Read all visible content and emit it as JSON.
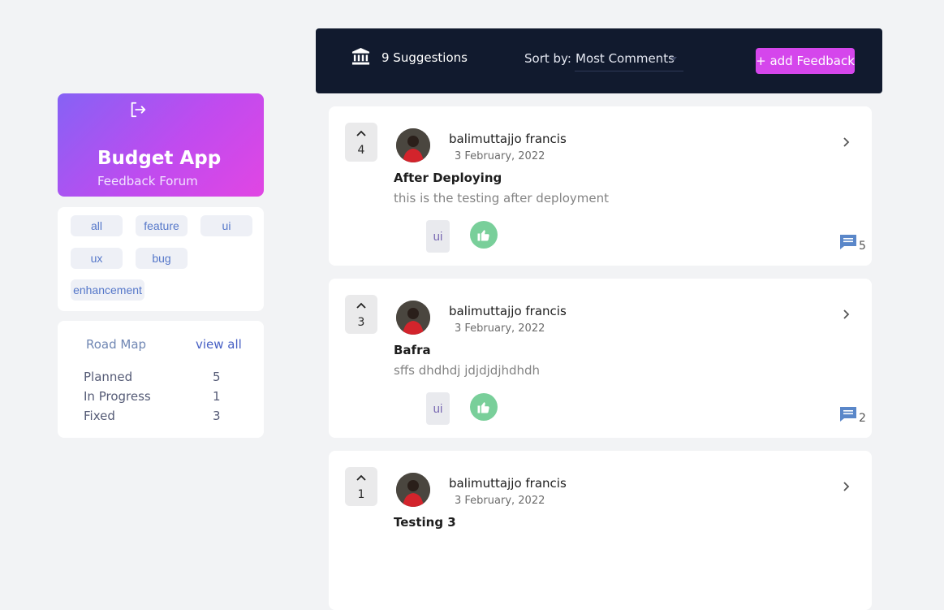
{
  "sidebar": {
    "brand": {
      "icon": "logout-icon",
      "title": "Budget App",
      "subtitle": "Feedback Forum"
    },
    "tags": [
      "all",
      "feature",
      "ui",
      "ux",
      "bug",
      "enhancement"
    ],
    "roadmap": {
      "title": "Road Map",
      "view_all": "view all",
      "rows": [
        {
          "label": "Planned",
          "count": "5"
        },
        {
          "label": "In Progress",
          "count": "1"
        },
        {
          "label": "Fixed",
          "count": "3"
        }
      ]
    }
  },
  "header": {
    "icon": "bank-icon",
    "suggestions": "9 Suggestions",
    "sort_label": "Sort by:",
    "sort_value": "Most Comments",
    "add_button": "+ add Feedback"
  },
  "colors": {
    "accent": "#d546ec",
    "header_bg": "#111a2e",
    "like_green": "#79cf9a",
    "gradient_start": "#8662f5",
    "gradient_end": "#e146e3"
  },
  "feedback": [
    {
      "votes": "4",
      "author": "balimuttajjo francis",
      "date": "3 February, 2022",
      "title": "After Deploying",
      "description": "this is the testing after deployment",
      "tag": "ui",
      "comments": "5"
    },
    {
      "votes": "3",
      "author": "balimuttajjo francis",
      "date": "3 February, 2022",
      "title": "Bafra",
      "description": "sffs dhdhdj jdjdjdjhdhdh",
      "tag": "ui",
      "comments": "2"
    },
    {
      "votes": "1",
      "author": "balimuttajjo francis",
      "date": "3 February, 2022",
      "title": "Testing 3",
      "description": "",
      "tag": "",
      "comments": ""
    }
  ]
}
